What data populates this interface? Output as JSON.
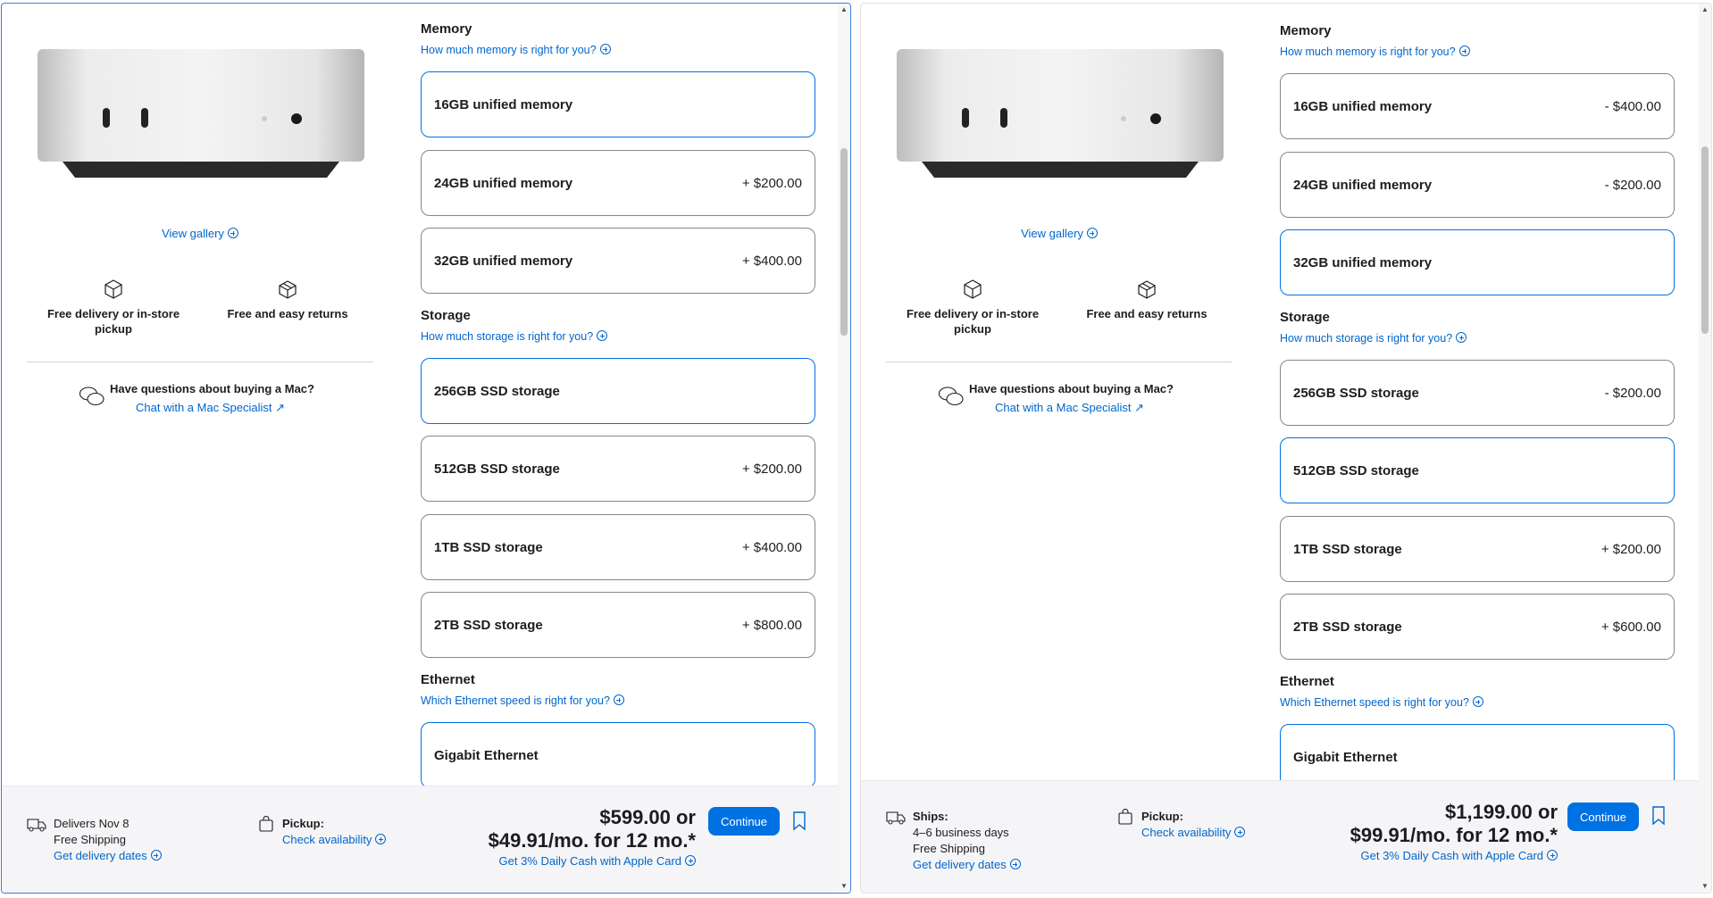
{
  "left": {
    "gallery": "View gallery",
    "features": [
      "Free delivery or in-store pickup",
      "Free and easy returns"
    ],
    "help_question": "Have questions about buying a Mac?",
    "help_link": "Chat with a Mac Specialist ↗",
    "memory": {
      "title": "Memory",
      "link": "How much memory is right for you?",
      "options": [
        {
          "label": "16GB unified memory",
          "price": ""
        },
        {
          "label": "24GB unified memory",
          "price": "+ $200.00"
        },
        {
          "label": "32GB unified memory",
          "price": "+ $400.00"
        }
      ]
    },
    "storage": {
      "title": "Storage",
      "link": "How much storage is right for you?",
      "options": [
        {
          "label": "256GB SSD storage",
          "price": ""
        },
        {
          "label": "512GB SSD storage",
          "price": "+ $200.00"
        },
        {
          "label": "1TB SSD storage",
          "price": "+ $400.00"
        },
        {
          "label": "2TB SSD storage",
          "price": "+ $800.00"
        }
      ]
    },
    "ethernet": {
      "title": "Ethernet",
      "link": "Which Ethernet speed is right for you?",
      "options": [
        {
          "label": "Gigabit Ethernet",
          "price": ""
        }
      ]
    },
    "footer": {
      "ship_line1": "Delivers Nov 8",
      "ship_line2": "Free Shipping",
      "ship_link": "Get delivery dates",
      "pickup_label": "Pickup:",
      "pickup_link": "Check availability",
      "price_line1": "$599.00 or",
      "price_line2": "$49.91/mo. for 12 mo.*",
      "cash": "Get 3% Daily Cash with Apple Card",
      "continue": "Continue"
    }
  },
  "right": {
    "gallery": "View gallery",
    "features": [
      "Free delivery or in-store pickup",
      "Free and easy returns"
    ],
    "help_question": "Have questions about buying a Mac?",
    "help_link": "Chat with a Mac Specialist ↗",
    "memory": {
      "title": "Memory",
      "link": "How much memory is right for you?",
      "options": [
        {
          "label": "16GB unified memory",
          "price": "- $400.00"
        },
        {
          "label": "24GB unified memory",
          "price": "- $200.00"
        },
        {
          "label": "32GB unified memory",
          "price": ""
        }
      ]
    },
    "storage": {
      "title": "Storage",
      "link": "How much storage is right for you?",
      "options": [
        {
          "label": "256GB SSD storage",
          "price": "- $200.00"
        },
        {
          "label": "512GB SSD storage",
          "price": ""
        },
        {
          "label": "1TB SSD storage",
          "price": "+ $200.00"
        },
        {
          "label": "2TB SSD storage",
          "price": "+ $600.00"
        }
      ]
    },
    "ethernet": {
      "title": "Ethernet",
      "link": "Which Ethernet speed is right for you?",
      "options": [
        {
          "label": "Gigabit Ethernet",
          "price": ""
        }
      ]
    },
    "footer": {
      "ship_label": "Ships:",
      "ship_line1": "4–6 business days",
      "ship_line2": "Free Shipping",
      "ship_link": "Get delivery dates",
      "pickup_label": "Pickup:",
      "pickup_link": "Check availability",
      "price_line1": "$1,199.00 or",
      "price_line2": "$99.91/mo. for 12 mo.*",
      "cash": "Get 3% Daily Cash with Apple Card",
      "continue": "Continue"
    }
  },
  "colors": {
    "accent": "#0071e3",
    "link": "#0066cc",
    "footer_bg": "#f5f5f7"
  }
}
